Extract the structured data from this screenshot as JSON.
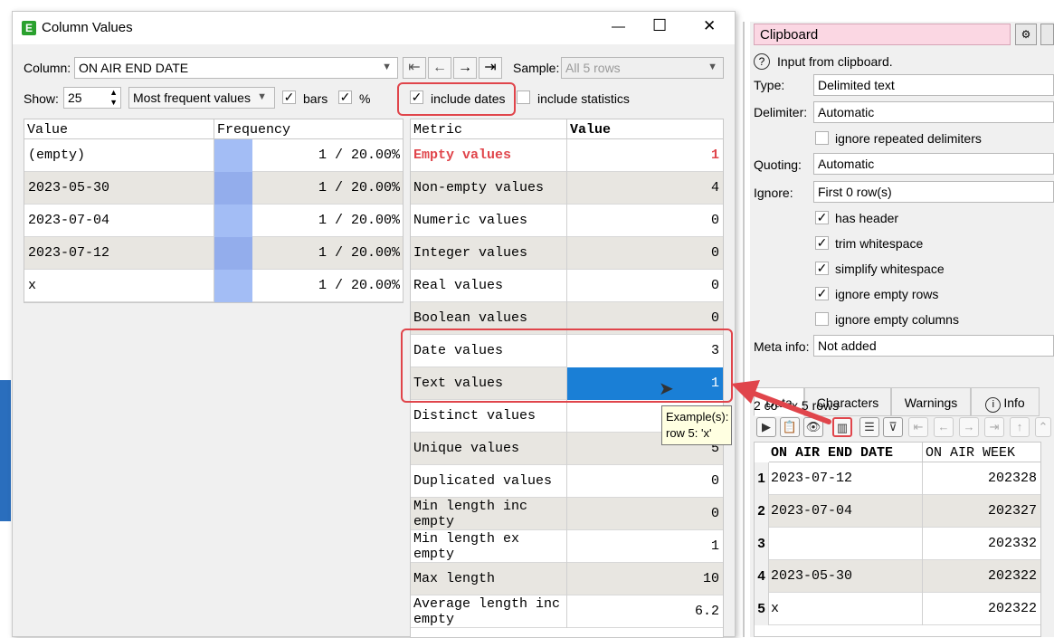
{
  "window": {
    "title": "Column Values",
    "app_icon": "easy-data-transform-icon",
    "controls": {
      "minimize": "—",
      "maximize": "☐",
      "close": "✕"
    }
  },
  "toolbar": {
    "column_label": "Column:",
    "column_value": "ON AIR END DATE",
    "sample_label": "Sample:",
    "sample_value": "All 5 rows",
    "show_label": "Show:",
    "show_value": "25",
    "mode_value": "Most frequent values",
    "bars_label": "bars",
    "bars_checked": true,
    "percent_label": "%",
    "percent_checked": true,
    "include_dates_label": "include dates",
    "include_dates_checked": true,
    "include_statistics_label": "include statistics",
    "include_statistics_checked": false
  },
  "freq_table": {
    "headers": [
      "Value",
      "Frequency"
    ],
    "rows": [
      {
        "value": "(empty)",
        "freq": "1 / 20.00%"
      },
      {
        "value": "2023-05-30",
        "freq": "1 / 20.00%"
      },
      {
        "value": "2023-07-04",
        "freq": "1 / 20.00%"
      },
      {
        "value": "2023-07-12",
        "freq": "1 / 20.00%"
      },
      {
        "value": "x",
        "freq": "1 / 20.00%"
      }
    ]
  },
  "metric_table": {
    "headers": [
      "Metric",
      "Value"
    ],
    "rows": [
      {
        "metric": "Empty values",
        "value": "1"
      },
      {
        "metric": "Non-empty values",
        "value": "4"
      },
      {
        "metric": "Numeric values",
        "value": "0"
      },
      {
        "metric": "Integer values",
        "value": "0"
      },
      {
        "metric": "Real values",
        "value": "0"
      },
      {
        "metric": "Boolean values",
        "value": "0"
      },
      {
        "metric": "Date values",
        "value": "3"
      },
      {
        "metric": "Text values",
        "value": "1"
      },
      {
        "metric": "Distinct values",
        "value": ""
      },
      {
        "metric": "Unique values",
        "value": "5"
      },
      {
        "metric": "Duplicated values",
        "value": "0"
      },
      {
        "metric": "Min length inc empty",
        "value": "0"
      },
      {
        "metric": "Min length ex empty",
        "value": "1"
      },
      {
        "metric": "Max length",
        "value": "10"
      },
      {
        "metric": "Average length inc empty",
        "value": "6.2"
      }
    ]
  },
  "tooltip": {
    "line1": "Example(s):",
    "line2": "row 5: 'x'"
  },
  "colors": {
    "accent_red": "#e0454b",
    "selection_blue": "#1a7fd6",
    "bar_blue": "#a3bdf5",
    "tooltip_bg": "#ffffe1"
  },
  "right_panel": {
    "title": "Clipboard",
    "input_info": "Input from clipboard.",
    "type_label": "Type:",
    "type_value": "Delimited text",
    "delimiter_label": "Delimiter:",
    "delimiter_value": "Automatic",
    "ignore_repeated_label": "ignore repeated delimiters",
    "quoting_label": "Quoting:",
    "quoting_value": "Automatic",
    "ignore_label": "Ignore:",
    "ignore_value": "First 0 row(s)",
    "options": [
      {
        "label": "has header",
        "checked": true
      },
      {
        "label": "trim whitespace",
        "checked": true
      },
      {
        "label": "simplify whitespace",
        "checked": true
      },
      {
        "label": "ignore empty rows",
        "checked": true
      },
      {
        "label": "ignore empty columns",
        "checked": false
      }
    ],
    "meta_label": "Meta info:",
    "meta_value": "Not added",
    "tabs": [
      "Data",
      "Characters",
      "Warnings",
      "Info"
    ],
    "summary": "2 co    x 5 rows",
    "data_headers": [
      "ON AIR END DATE",
      "ON AIR WEEK"
    ],
    "data_rows": [
      {
        "n": "1",
        "date": "2023-07-12",
        "week": "202328"
      },
      {
        "n": "2",
        "date": "2023-07-04",
        "week": "202327"
      },
      {
        "n": "3",
        "date": "",
        "week": "202332"
      },
      {
        "n": "4",
        "date": "2023-05-30",
        "week": "202322"
      },
      {
        "n": "5",
        "date": "x",
        "week": "202322"
      }
    ]
  }
}
